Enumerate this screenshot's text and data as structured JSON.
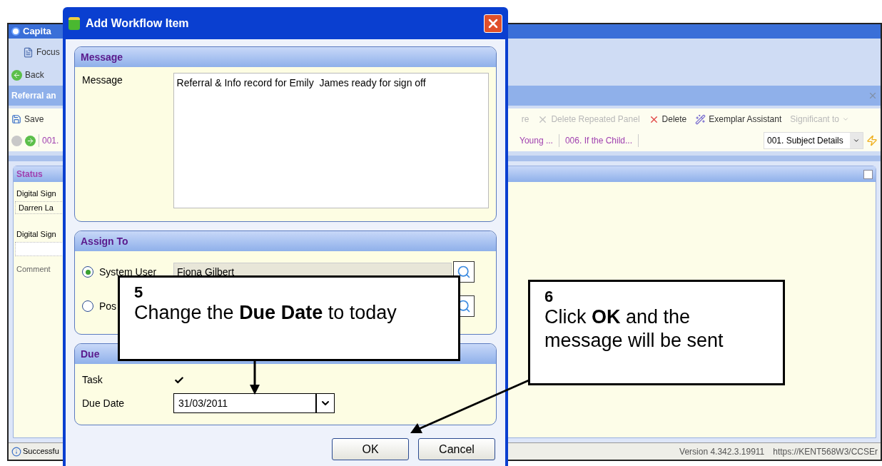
{
  "app": {
    "title": "Capita",
    "focus": "Focus",
    "back": "Back",
    "form_title": "Referral an",
    "save": "Save",
    "actions": [
      {
        "label": "re",
        "disabled": true,
        "kind": "plain"
      },
      {
        "label": "Delete Repeated Panel",
        "disabled": true,
        "kind": "delete"
      },
      {
        "label": "Delete",
        "disabled": false,
        "kind": "delete"
      },
      {
        "label": "Exemplar Assistant",
        "disabled": false,
        "kind": "assistant"
      },
      {
        "label": "Significant to",
        "disabled": true,
        "kind": "menu"
      }
    ],
    "left_tab": "001.",
    "tabs": [
      "Young ...",
      "006. If the Child..."
    ],
    "section_select": "001. Subject Details",
    "status_panel": {
      "title": "Status",
      "checked": false,
      "label_1": "Digital Sign",
      "value_1": "Darren La",
      "label_2": "Digital Sign",
      "label_3": "Comment"
    },
    "status_bar": {
      "message": "Successfu",
      "version": "Version 4.342.3.19911",
      "url": "https://KENT568W3/CCSEr"
    }
  },
  "dialog": {
    "title": "Add Workflow Item",
    "message": {
      "title": "Message",
      "label": "Message",
      "value": "Referral & Info record for Emily  James ready for sign off"
    },
    "assign_to": {
      "title": "Assign To",
      "options": [
        {
          "label": "System User",
          "selected": true,
          "value": "Fiona Gilbert"
        },
        {
          "label": "Pos",
          "selected": false
        }
      ]
    },
    "due": {
      "title": "Due",
      "task_label": "Task",
      "task_checked": true,
      "date_label": "Due Date",
      "date": "31/03/2011"
    },
    "buttons": [
      "OK",
      "Cancel"
    ]
  },
  "callouts": [
    {
      "number": "5",
      "text": "Change the **Due Date** to today"
    },
    {
      "number": "6",
      "text": "Click **OK** and the message will be sent"
    }
  ]
}
